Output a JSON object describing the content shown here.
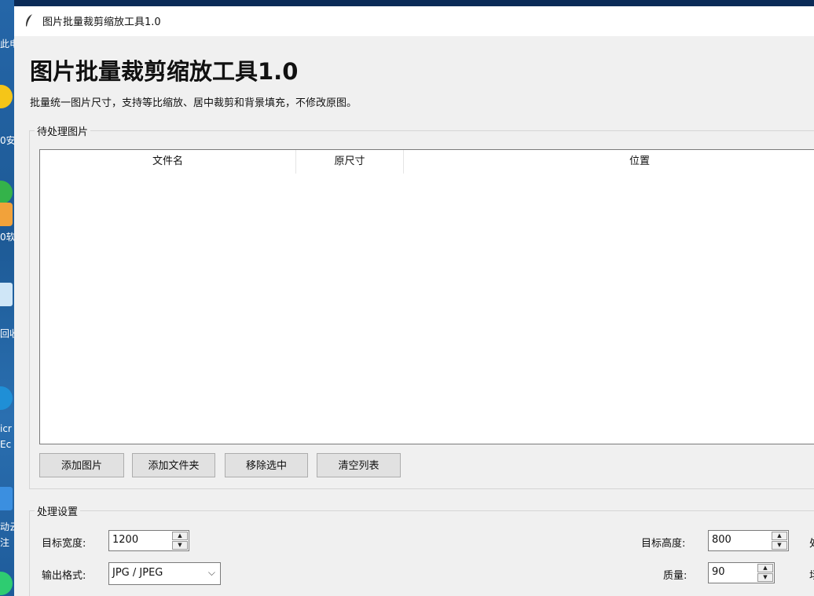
{
  "window": {
    "title": "图片批量裁剪缩放工具1.0"
  },
  "header": {
    "title": "图片批量裁剪缩放工具1.0",
    "subtitle": "批量统一图片尺寸，支持等比缩放、居中裁剪和背景填充，不修改原图。"
  },
  "files_group": {
    "label": "待处理图片",
    "columns": [
      "文件名",
      "原尺寸",
      "位置"
    ],
    "rows": []
  },
  "buttons": {
    "add_image": "添加图片",
    "add_folder": "添加文件夹",
    "remove_selected": "移除选中",
    "clear_list": "清空列表"
  },
  "settings": {
    "label": "处理设置",
    "target_width_label": "目标宽度:",
    "target_width_value": "1200",
    "target_height_label": "目标高度:",
    "target_height_value": "800",
    "output_format_label": "输出格式:",
    "output_format_value": "JPG / JPEG",
    "quality_label": "质量:",
    "quality_value": "90",
    "right_clip_1": "处",
    "right_clip_2": "场"
  },
  "desktop": {
    "labels": [
      "此电",
      "0安",
      "0软",
      "回收",
      "icr",
      "Ec",
      "动云",
      "注"
    ]
  }
}
